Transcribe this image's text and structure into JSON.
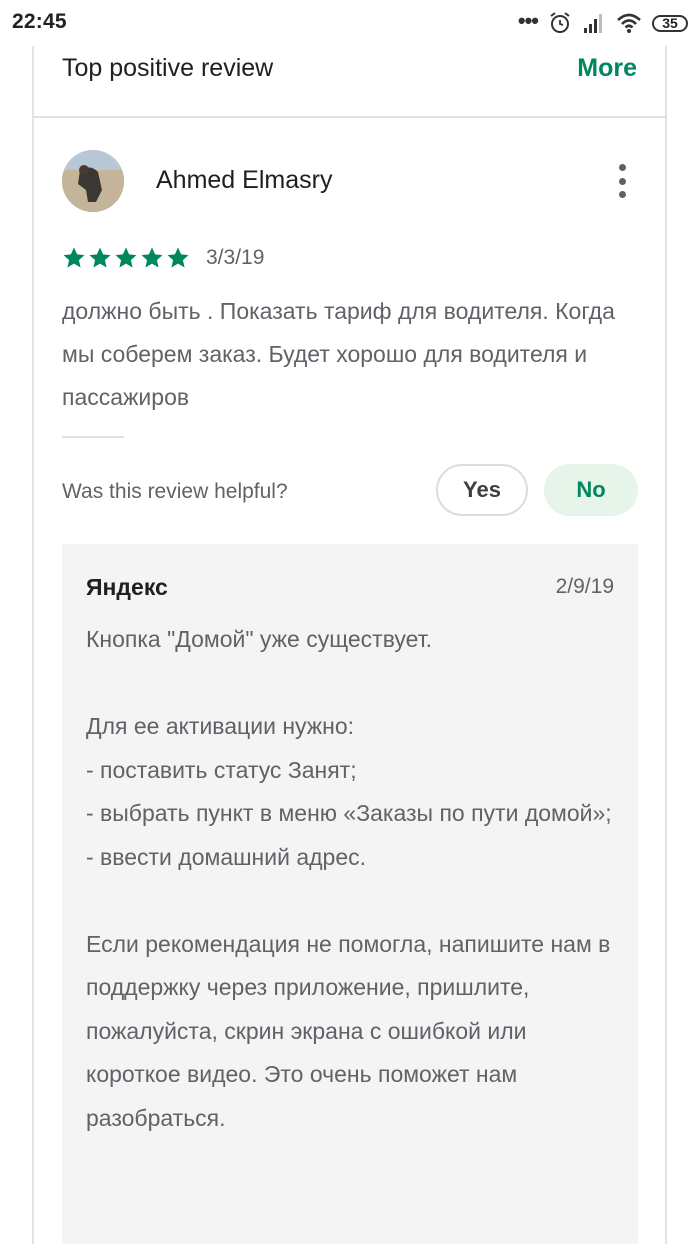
{
  "status_bar": {
    "time": "22:45",
    "icons": [
      "more-dots-icon",
      "alarm-icon",
      "signal-icon",
      "wifi-icon",
      "battery-icon"
    ],
    "battery_level": "35"
  },
  "section": {
    "title": "Top positive review",
    "more_label": "More",
    "accent_color": "#01875f"
  },
  "review": {
    "reviewer_name": "Ahmed Elmasry",
    "rating": 5,
    "rating_max": 5,
    "date": "3/3/19",
    "text": "должно быть . Показать тариф для водителя. Когда мы соберем заказ. Будет хорошо для водителя и пассажиров",
    "helpful_question": "Was this review helpful?",
    "yes_label": "Yes",
    "no_label": "No",
    "selected_vote": "No"
  },
  "developer_reply": {
    "author": "Яндекс",
    "date": "2/9/19",
    "text": "Кнопка \"Домой\" уже существует.\n\nДля ее активации нужно:\n- поставить статус Занят;\n- выбрать пункт в меню «Заказы по пути домой»;\n- ввести домашний адрес.\n\nЕсли рекомендация не помогла, напишите нам в поддержку через приложение, пришлите, пожалуйста, скрин экрана с ошибкой или короткое видео. Это очень поможет нам разобраться."
  }
}
